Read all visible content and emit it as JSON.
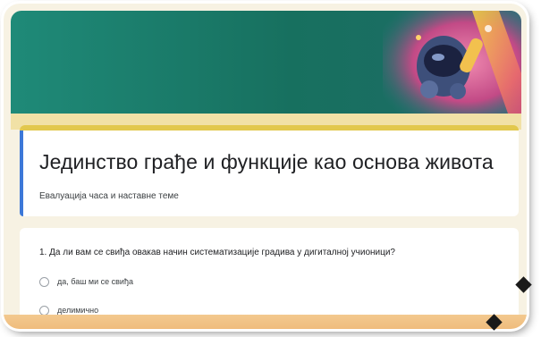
{
  "form": {
    "title": "Јединство грађе и функције као основа живота",
    "description": "Евалуација часа и наставне теме"
  },
  "question": {
    "text": "1. Да ли вам се свиђа овакав начин систематизације градива у дигиталној учионици?",
    "options": [
      {
        "label": "да, баш ми се свиђа"
      },
      {
        "label": "делимично"
      }
    ]
  },
  "colors": {
    "banner": "#1f8a78",
    "title_accent": "#3c78d8",
    "title_top_border": "#e2c84d",
    "page_background": "#f7f2e3"
  },
  "icons": {
    "banner_art": "astronaut-illustration",
    "radio": "radio-unchecked-icon"
  }
}
